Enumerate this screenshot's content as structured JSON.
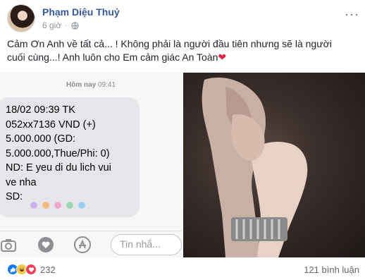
{
  "post": {
    "author": "Phạm Diệu Thuỷ",
    "time": "6 giờ",
    "separator": "·",
    "more": "···",
    "caption": {
      "line1": "Cảm Ơn Anh về tất cả... ! Không phải là người đầu tiên nhưng sẽ là người",
      "line2": "cuối cùng...! Anh luôn cho Em cảm giác An Toàn"
    },
    "heart": "❤",
    "screenshot": {
      "timestamp_day": "Hôm nay",
      "timestamp_time": "09:41",
      "sms_lines": [
        "18/02 09:39 TK",
        "052xx7136 VND (+)",
        "5.000.000 (GD:",
        "5.000.000,Thue/Phi: 0)",
        "ND: E yeu di du lich vui",
        "ve nha",
        "SD:"
      ],
      "input_placeholder": "Tin nhắ..."
    },
    "footer": {
      "reaction_count": "232",
      "comments": "121 bình luận"
    },
    "colors": {
      "author": "#385898",
      "like": "#1877f2",
      "love": "#f33e58",
      "haha": "#f7c64a",
      "bubble": "#e5e5ea"
    }
  }
}
